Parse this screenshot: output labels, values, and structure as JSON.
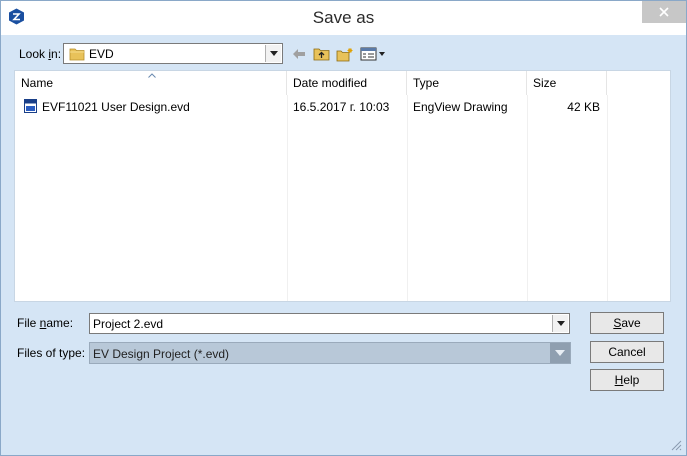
{
  "window": {
    "title": "Save as"
  },
  "lookin": {
    "label_pre": "Look ",
    "label_accel": "i",
    "label_post": "n:",
    "value": "EVD"
  },
  "columns": {
    "name": "Name",
    "date_modified": "Date modified",
    "type": "Type",
    "size": "Size"
  },
  "files": [
    {
      "name": "EVF11021 User Design.evd",
      "date_modified": "16.5.2017 г. 10:03",
      "type": "EngView Drawing",
      "size": "42 KB"
    }
  ],
  "filename": {
    "label_pre": "File ",
    "label_accel": "n",
    "label_post": "ame:",
    "value": "Project 2.evd"
  },
  "filetype": {
    "label": "Files of type:",
    "value": "EV Design Project (*.evd)"
  },
  "buttons": {
    "save_accel": "S",
    "save_rest": "ave",
    "cancel": "Cancel",
    "help_accel": "H",
    "help_rest": "elp"
  },
  "icons": {
    "app": "engview-app-icon",
    "back": "back-arrow-icon",
    "up": "up-folder-icon",
    "new_folder": "new-folder-icon",
    "view_menu": "view-menu-icon"
  },
  "colors": {
    "dialog_bg": "#d5e5f5",
    "accent": "#1a4fa0"
  }
}
